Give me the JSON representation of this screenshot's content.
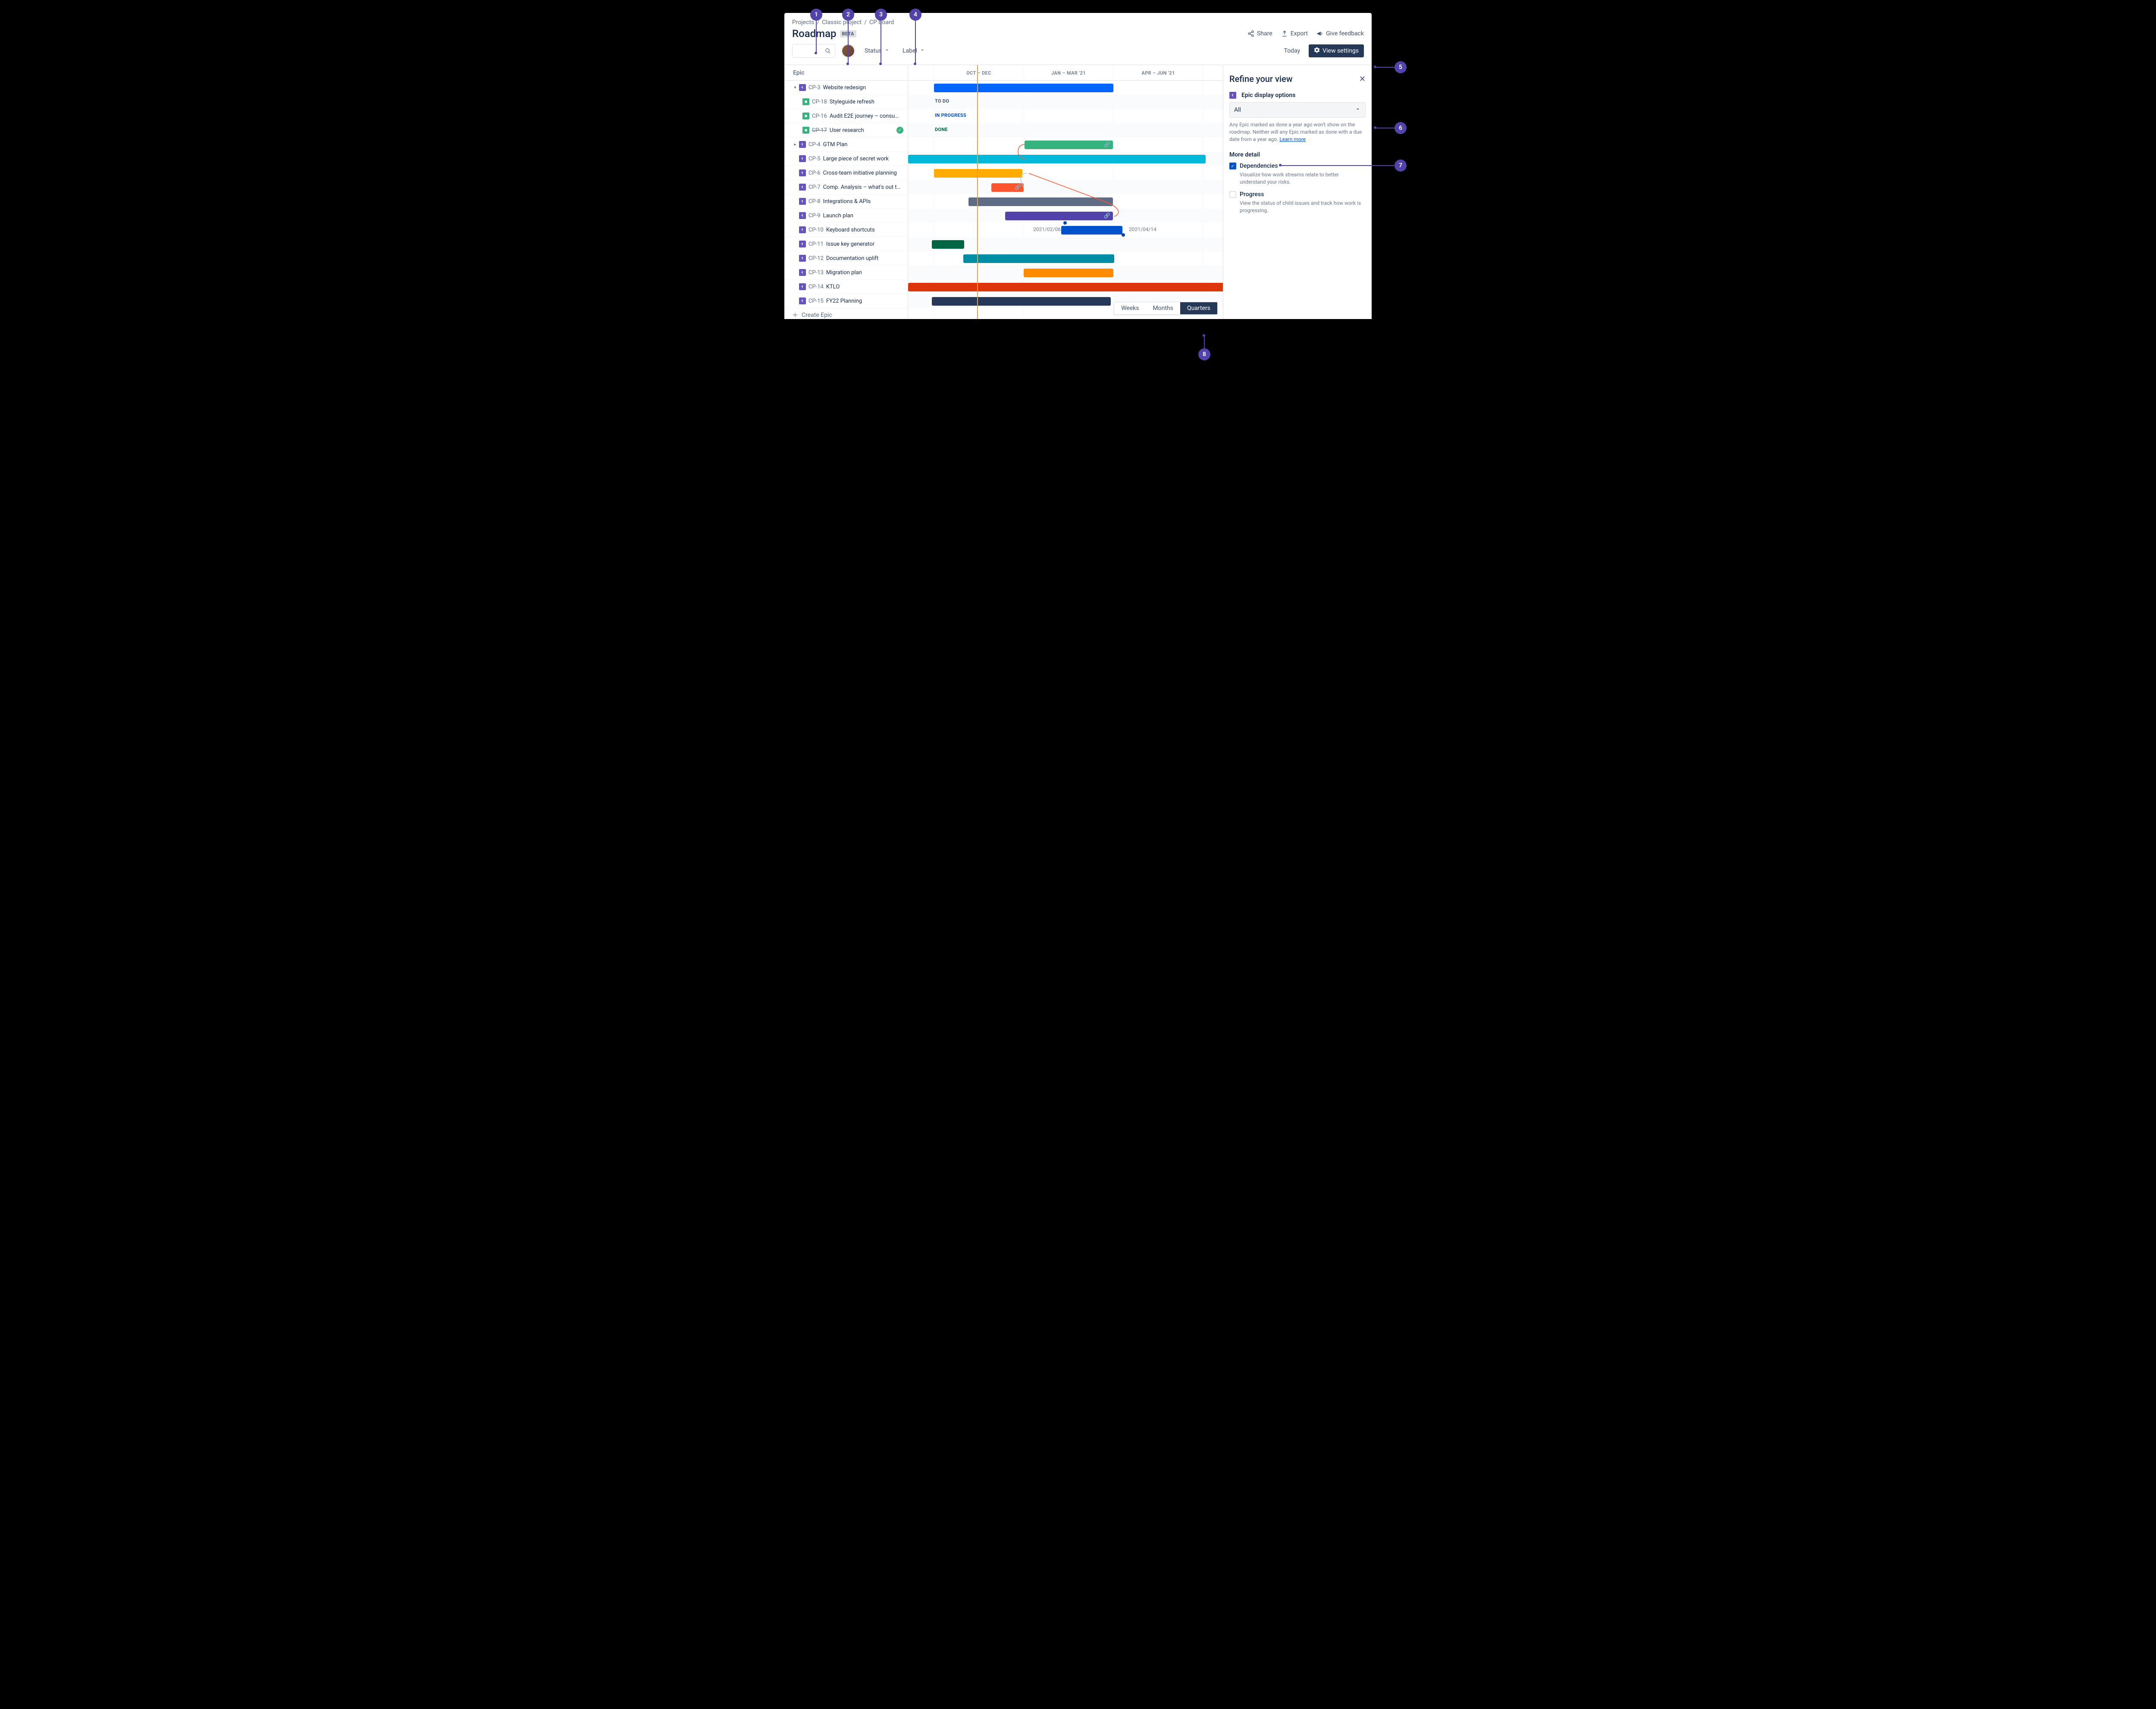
{
  "breadcrumb": [
    "Projects",
    "Classic project",
    "CP board"
  ],
  "page_title": "Roadmap",
  "beta_badge": "BETA",
  "actions": {
    "share": "Share",
    "export": "Export",
    "feedback": "Give feedback"
  },
  "filters": {
    "status": "Status",
    "label": "Label",
    "today": "Today",
    "view_settings": "View settings"
  },
  "left_header": "Epic",
  "epics": [
    {
      "key": "CP-3",
      "name": "Website redesign",
      "expanded": true,
      "caret": "down"
    },
    {
      "key": "CP-18",
      "name": "Styleguide refresh",
      "child": true,
      "icon": "green",
      "status": "TO DO"
    },
    {
      "key": "CP-16",
      "name": "Audit E2E journey – consu…",
      "child": true,
      "icon": "green",
      "status": "IN PROGRESS"
    },
    {
      "key": "CP-17",
      "name": "User research",
      "child": true,
      "icon": "green",
      "strike": true,
      "done": true,
      "status": "DONE"
    },
    {
      "key": "CP-4",
      "name": "GTM Plan",
      "caret": "right"
    },
    {
      "key": "CP-5",
      "name": "Large piece of secret work"
    },
    {
      "key": "CP-6",
      "name": "Cross-team initiative planning"
    },
    {
      "key": "CP-7",
      "name": "Comp. Analysis – what's out the…"
    },
    {
      "key": "CP-8",
      "name": "Integrations & APIs"
    },
    {
      "key": "CP-9",
      "name": "Launch plan"
    },
    {
      "key": "CP-10",
      "name": "Keyboard shortcuts",
      "date_start": "2021/02/06",
      "date_end": "2021/04/14"
    },
    {
      "key": "CP-11",
      "name": "Issue key generator"
    },
    {
      "key": "CP-12",
      "name": "Documentation uplift"
    },
    {
      "key": "CP-13",
      "name": "Migration plan"
    },
    {
      "key": "CP-14",
      "name": "KTLO"
    },
    {
      "key": "CP-15",
      "name": "FY22 Planning"
    }
  ],
  "create_epic": "Create Epic",
  "timeline": {
    "quarters": [
      "OCT – DEC",
      "JAN – MAR '21",
      "APR – JUN '21"
    ]
  },
  "panel": {
    "title": "Refine your view",
    "epic_display": "Epic display options",
    "select_value": "All",
    "help": "Any Epic marked as done a year ago won't show on the roadmap. Neither will any Epic marked as done with a due date from a year ago.",
    "learn_more": "Learn more",
    "more_detail": "More detail",
    "dependencies": {
      "label": "Dependencies",
      "desc": "Visualize how work streams relate to better understand your risks."
    },
    "progress": {
      "label": "Progress",
      "desc": "View the status of child issues and track how work is progressing."
    }
  },
  "zoom": {
    "weeks": "Weeks",
    "months": "Months",
    "quarters": "Quarters"
  },
  "callouts": [
    "1",
    "2",
    "3",
    "4",
    "5",
    "6",
    "7",
    "8"
  ]
}
